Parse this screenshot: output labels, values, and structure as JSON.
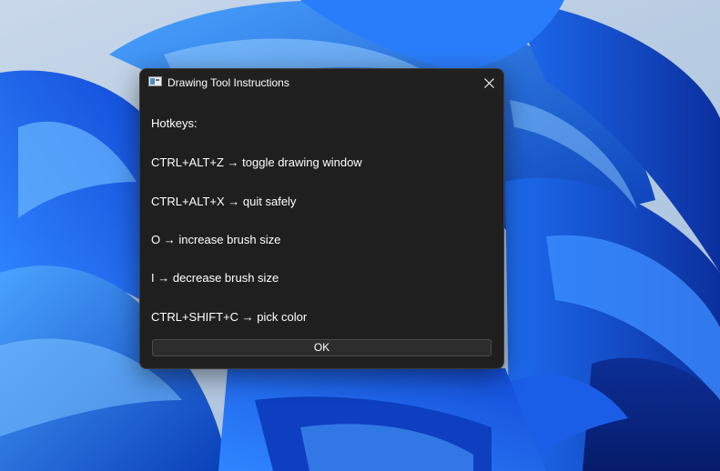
{
  "window": {
    "title": "Drawing Tool Instructions",
    "icon": "app-window-icon"
  },
  "instructions": {
    "heading": "Hotkeys:",
    "lines": [
      "CTRL+ALT+Z → toggle drawing window",
      "CTRL+ALT+X → quit safely",
      "O → increase brush size",
      "I → decrease brush size",
      "CTRL+SHIFT+C → pick color"
    ]
  },
  "buttons": {
    "ok_label": "OK"
  },
  "colors": {
    "dialog_background": "#1f1f1f",
    "text": "#ffffff",
    "wallpaper_accent": "#1565e6"
  }
}
